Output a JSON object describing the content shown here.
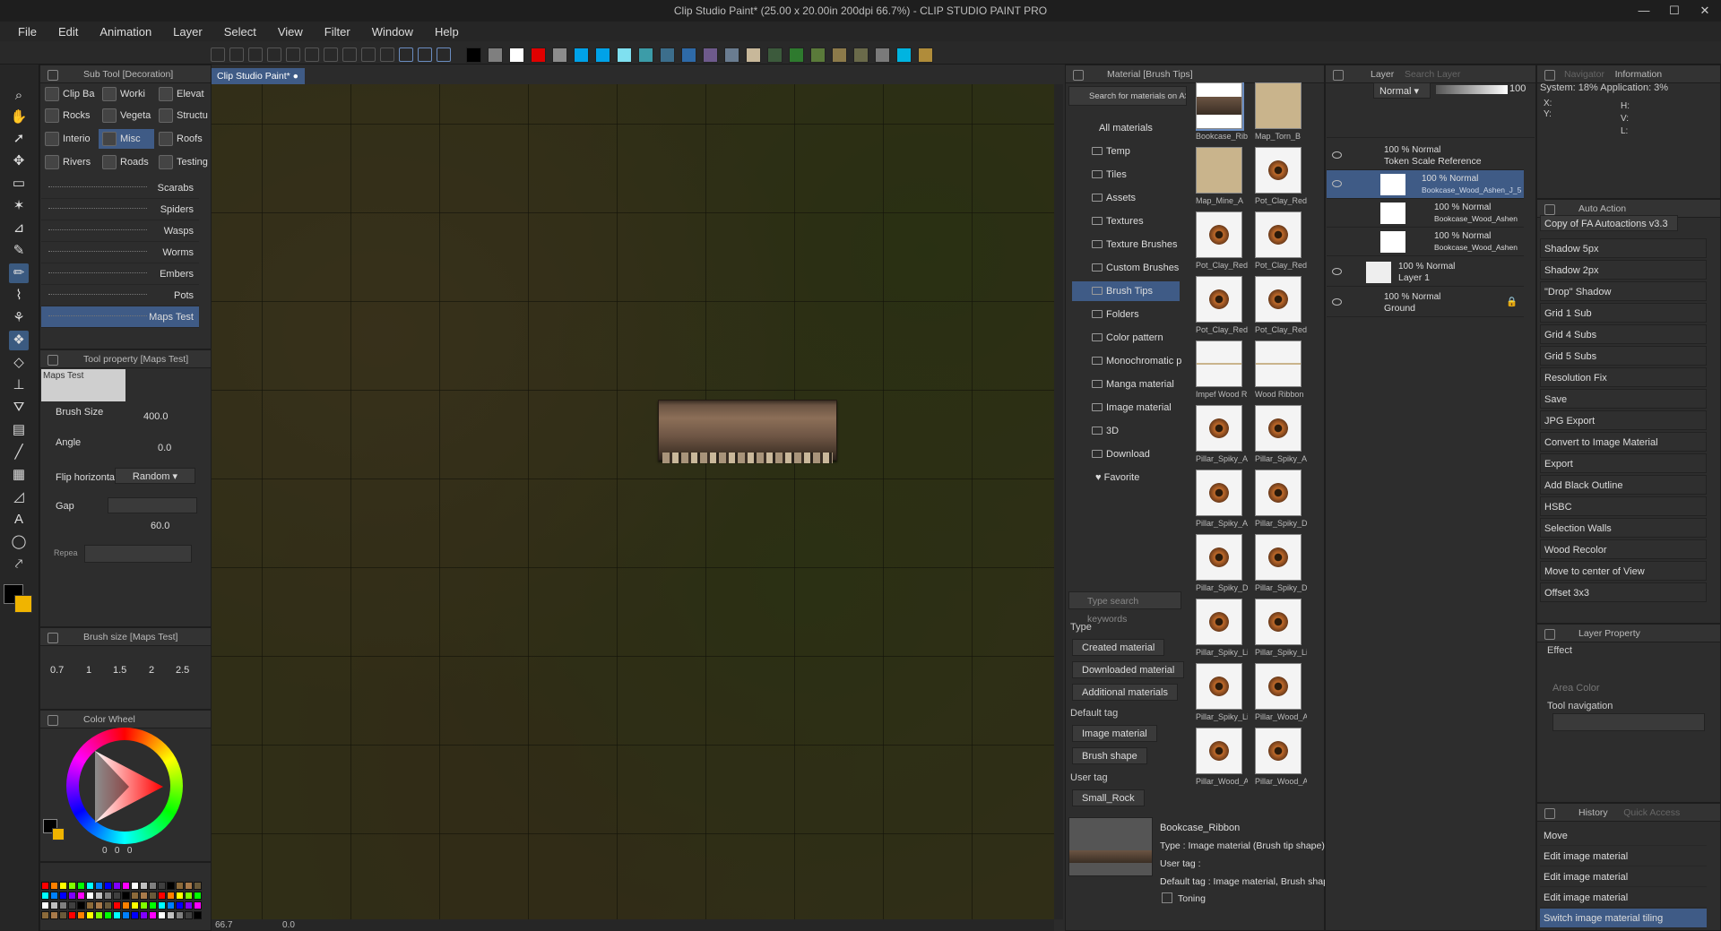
{
  "app": {
    "title": "Clip Studio Paint* (25.00 x 20.00in 200dpi 66.7%) - CLIP STUDIO PAINT PRO"
  },
  "menu": [
    "File",
    "Edit",
    "Animation",
    "Layer",
    "Select",
    "View",
    "Filter",
    "Window",
    "Help"
  ],
  "colors": {
    "accent": "#3f5b86",
    "fg": "#000000",
    "bg": "#f0b400"
  },
  "palette": [
    "#000000",
    "#7f7f7f",
    "#ffffff",
    "#e00000",
    "#8c8c8c",
    "#00a2e8",
    "#00a2e8",
    "#7fe0f0",
    "#3c9ca8",
    "#3c6e8c",
    "#2e6aa8",
    "#6e5a8c",
    "#6a7c90",
    "#c8b89a",
    "#3c5a3c",
    "#2e7a2e",
    "#5a7a3a",
    "#8c7a4a",
    "#6a6a4a",
    "#7a7a7a",
    "#00b4e0",
    "#b08c3a"
  ],
  "subtool": {
    "header": "Sub Tool [Decoration]",
    "groups": [
      [
        "Clip Ba",
        "Worki",
        "Elevat"
      ],
      [
        "Rocks",
        "Vegeta",
        "Structu"
      ],
      [
        "Interio",
        "Misc",
        "Roofs"
      ],
      [
        "Rivers",
        "Roads",
        "Testing"
      ]
    ],
    "brushes": [
      "Scarabs",
      "Spiders",
      "Wasps",
      "Worms",
      "Embers",
      "Pots",
      "Maps Test"
    ]
  },
  "toolprop": {
    "header": "Tool property [Maps Test]",
    "preset": "Maps Test",
    "brush_size_label": "Brush Size",
    "brush_size": "400.0",
    "angle_label": "Angle",
    "angle": "0.0",
    "flip_label": "Flip horizontal",
    "flip_value": "Random",
    "gap_label": "Gap",
    "gap": "60.0",
    "repeat_label": "Repea"
  },
  "brushsize": {
    "header": "Brush size [Maps Test]",
    "sizes": [
      "0.7",
      "1",
      "1.5",
      "2",
      "2.5"
    ]
  },
  "colorwheel": {
    "header": "Color Wheel",
    "readout": [
      "0",
      "0",
      "0"
    ]
  },
  "doc": {
    "tab": "Clip Studio Paint*"
  },
  "status": {
    "zoom": "66.7",
    "angle": "0.0"
  },
  "material": {
    "header": "Material [Brush Tips]",
    "search_assets": "Search for materials on ASSE",
    "tree": [
      "All materials",
      "Temp",
      "Tiles",
      "Assets",
      "Textures",
      "Texture Brushes",
      "Custom Brushes",
      "Brush Tips",
      "Folders",
      "Color pattern",
      "Monochromatic p",
      "Manga material",
      "Image material",
      "3D",
      "Download",
      "Favorite"
    ],
    "search_placeholder": "Type search keywords",
    "type_label": "Type",
    "type_tags": [
      "Created material",
      "Downloaded material",
      "Additional materials"
    ],
    "default_tag_label": "Default tag",
    "default_tags": [
      "Image material",
      "Brush shape"
    ],
    "user_tag_label": "User tag",
    "user_tags": [
      "Small_Rock"
    ],
    "thumbs": [
      "Bookcase_Rib",
      "Map_Torn_B",
      "Map_Mine_A",
      "Pot_Clay_Red",
      "Pot_Clay_Red",
      "Pot_Clay_Red",
      "Pot_Clay_Red",
      "Pot_Clay_Red",
      "Impef Wood R",
      "Wood Ribbon",
      "Pillar_Spiky_A",
      "Pillar_Spiky_A",
      "Pillar_Spiky_A",
      "Pillar_Spiky_D",
      "Pillar_Spiky_D",
      "Pillar_Spiky_D",
      "Pillar_Spiky_Li",
      "Pillar_Spiky_Li",
      "Pillar_Spiky_Li",
      "Pillar_Wood_A",
      "Pillar_Wood_A",
      "Pillar_Wood_A"
    ],
    "detail": {
      "name": "Bookcase_Ribbon",
      "type": "Type : Image material (Brush tip shape)",
      "user_tag": "User tag :",
      "default_tag": "Default tag : Image material, Brush shape",
      "toning": "Toning"
    }
  },
  "layer": {
    "header": "Layer",
    "search": "Search Layer",
    "blend": "Normal",
    "opacity": "100",
    "rows": [
      {
        "mode": "100 % Normal",
        "name": "Token Scale Reference"
      },
      {
        "mode": "100 % Normal",
        "name": "Bookcase_Wood_Ashen_J_5"
      },
      {
        "mode": "100 % Normal",
        "name": "Bookcase_Wood_Ashen"
      },
      {
        "mode": "100 % Normal",
        "name": "Bookcase_Wood_Ashen"
      },
      {
        "mode": "100 % Normal",
        "name": "Layer 1"
      },
      {
        "mode": "100 % Normal",
        "name": "Ground"
      }
    ]
  },
  "info": {
    "tabs": [
      "Navigator",
      "Information"
    ],
    "system": "System: 18% Application: 3%",
    "labels": [
      "X:",
      "Y:",
      "H:",
      "V:",
      "L:"
    ]
  },
  "autoaction": {
    "header": "Auto Action",
    "set": "Copy of FA Autoactions v3.3",
    "items": [
      "Shadow 5px",
      "Shadow 2px",
      "\"Drop\" Shadow",
      "Grid 1 Sub",
      "Grid 4 Subs",
      "Grid 5 Subs",
      "Resolution Fix",
      "Save",
      "JPG Export",
      "Convert to Image Material",
      "Export",
      "Add Black Outline",
      "HSBC",
      "Selection Walls",
      "Wood Recolor",
      "Move to center of View",
      "Offset 3x3"
    ]
  },
  "layerprop": {
    "header": "Layer Property",
    "effect": "Effect",
    "area_color": "Area Color",
    "toolnav": "Tool navigation"
  },
  "history": {
    "tabs": [
      "History",
      "Quick Access"
    ],
    "items": [
      "Move",
      "Edit image material",
      "Edit image material",
      "Edit image material",
      "Switch image material tiling"
    ]
  }
}
